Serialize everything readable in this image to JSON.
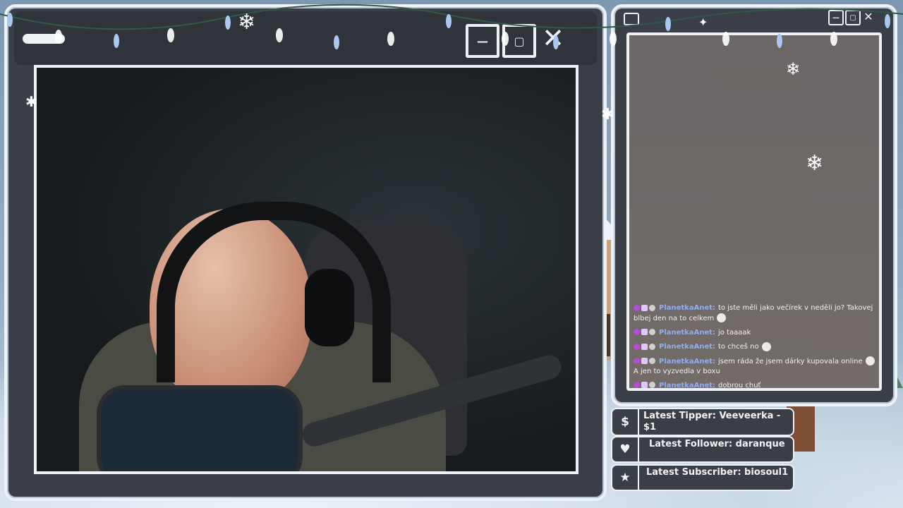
{
  "scene": {
    "colors": {
      "window_border": "#eef2f6",
      "window_bg": "#3a3f47",
      "chat_username": "#92aef0",
      "badge_heart": "#b44cd6"
    }
  },
  "cam_window": {
    "controls": {
      "minimize_icon": "minus-icon",
      "maximize_icon": "square-icon",
      "close_icon": "close-icon"
    }
  },
  "chat_window": {
    "controls": {
      "minimize_icon": "minus-icon",
      "maximize_icon": "square-icon",
      "close_icon": "close-icon"
    },
    "messages": [
      {
        "user": "PlanetkaAnet:",
        "text": "to jste měli jako večírek v neděli jo? Takovej blbej den na to celkem",
        "emote": true
      },
      {
        "user": "PlanetkaAnet:",
        "text": "jo taaaak",
        "emote": false
      },
      {
        "user": "PlanetkaAnet:",
        "text": "to chceš no",
        "emote": true
      },
      {
        "user": "PlanetkaAnet:",
        "text": "jsem ráda že jsem dárky kupovala online",
        "text2": "A jen to vyzvedla v boxu",
        "emote": true
      },
      {
        "user": "PlanetkaAnet:",
        "text": "dobrou chuť",
        "emote": false
      }
    ]
  },
  "alerts": {
    "tipper": {
      "icon": "dollar-icon",
      "label": "Latest Tipper: Veeveerka - $1"
    },
    "follower": {
      "icon": "heart-icon",
      "label": "Latest Follower: daranque"
    },
    "subscriber": {
      "icon": "star-icon",
      "label": "Latest Subscriber: biosoul1"
    }
  }
}
